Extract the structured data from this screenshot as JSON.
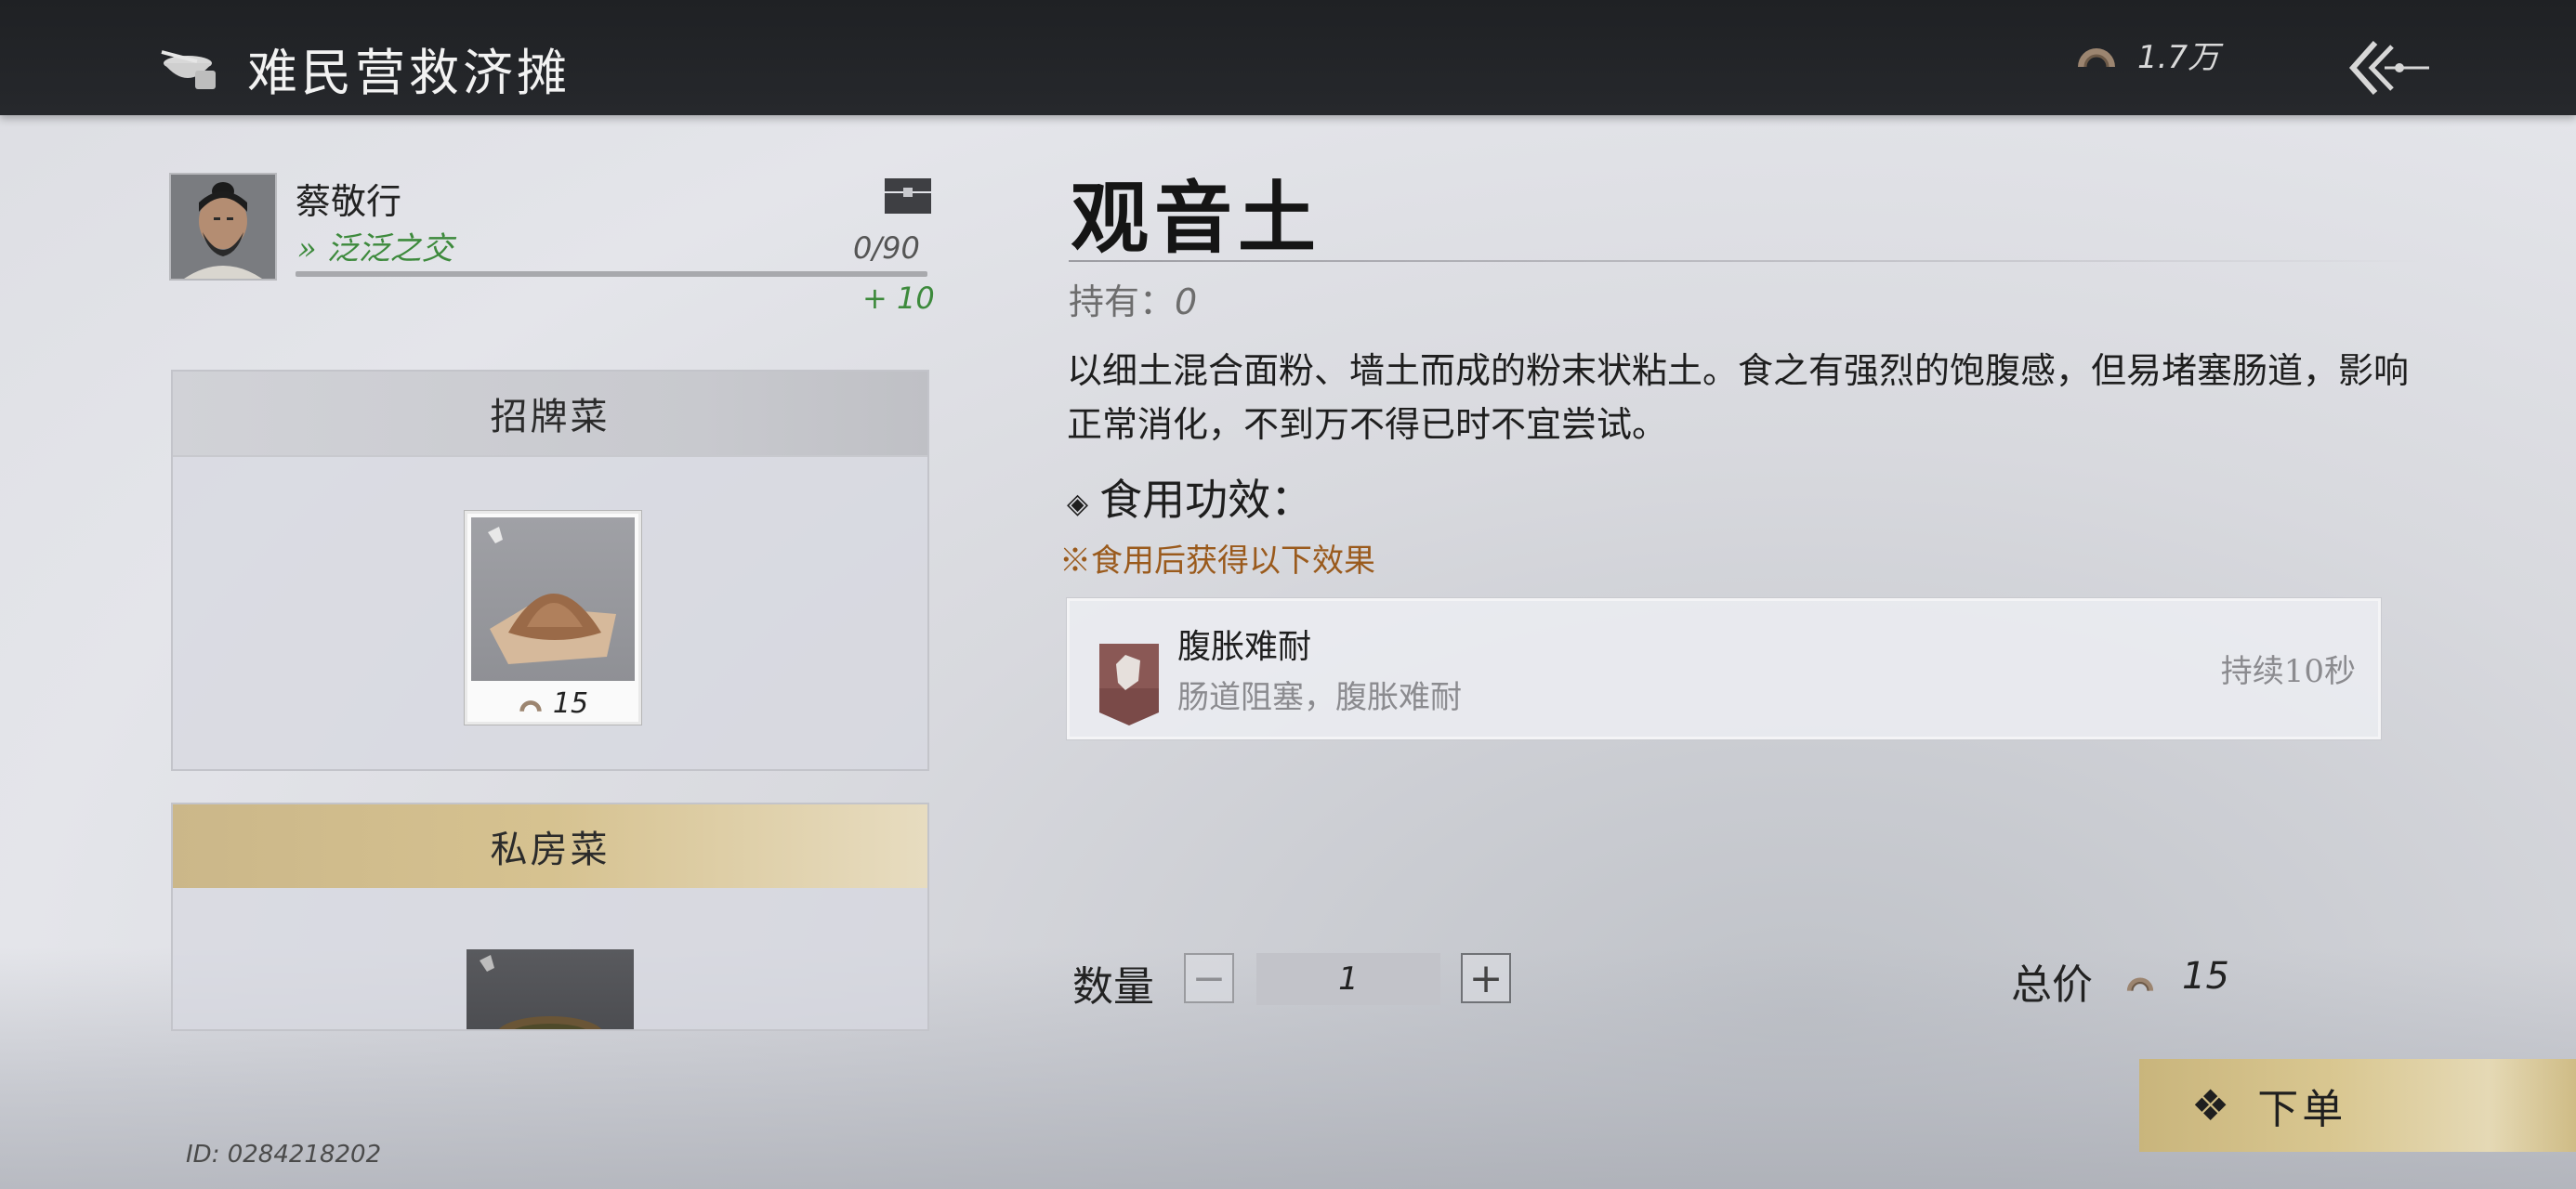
{
  "header": {
    "title": "难民营救济摊",
    "currency": "1.7万",
    "icons": {
      "stall": "bowl-icon",
      "currency": "coin-icon",
      "back": "back-arrow-icon"
    }
  },
  "npc": {
    "name": "蔡敬行",
    "relation": "» 泛泛之交",
    "favor": "0/90",
    "favor_progress": 0,
    "favor_gain": "+ 10"
  },
  "menu": {
    "signature": {
      "title": "招牌菜",
      "items": [
        {
          "price": "15"
        }
      ]
    },
    "private": {
      "title": "私房菜"
    }
  },
  "player_id": "ID: 0284218202",
  "item": {
    "name": "观音土",
    "owned_label": "持有：",
    "owned_value": "0",
    "description": "以细土混合面粉、墙土而成的粉末状粘土。食之有强烈的饱腹感，但易堵塞肠道，影响正常消化，不到万不得已时不宜尝试。",
    "effect_heading": "食用功效：",
    "effect_note": "※食用后获得以下效果",
    "effect": {
      "name": "腹胀难耐",
      "desc": "肠道阻塞，腹胀难耐",
      "duration": "持续10秒"
    }
  },
  "order": {
    "quantity_label": "数量",
    "quantity": "1",
    "minus": "−",
    "plus": "+",
    "total_label": "总价",
    "total": "15",
    "button_label": "下单",
    "button_icon": "❖"
  },
  "colors": {
    "topbar": "#23252a",
    "relation_green": "#3d8a3c",
    "note_brown": "#9a5a1c",
    "gold": "#d6c290"
  }
}
